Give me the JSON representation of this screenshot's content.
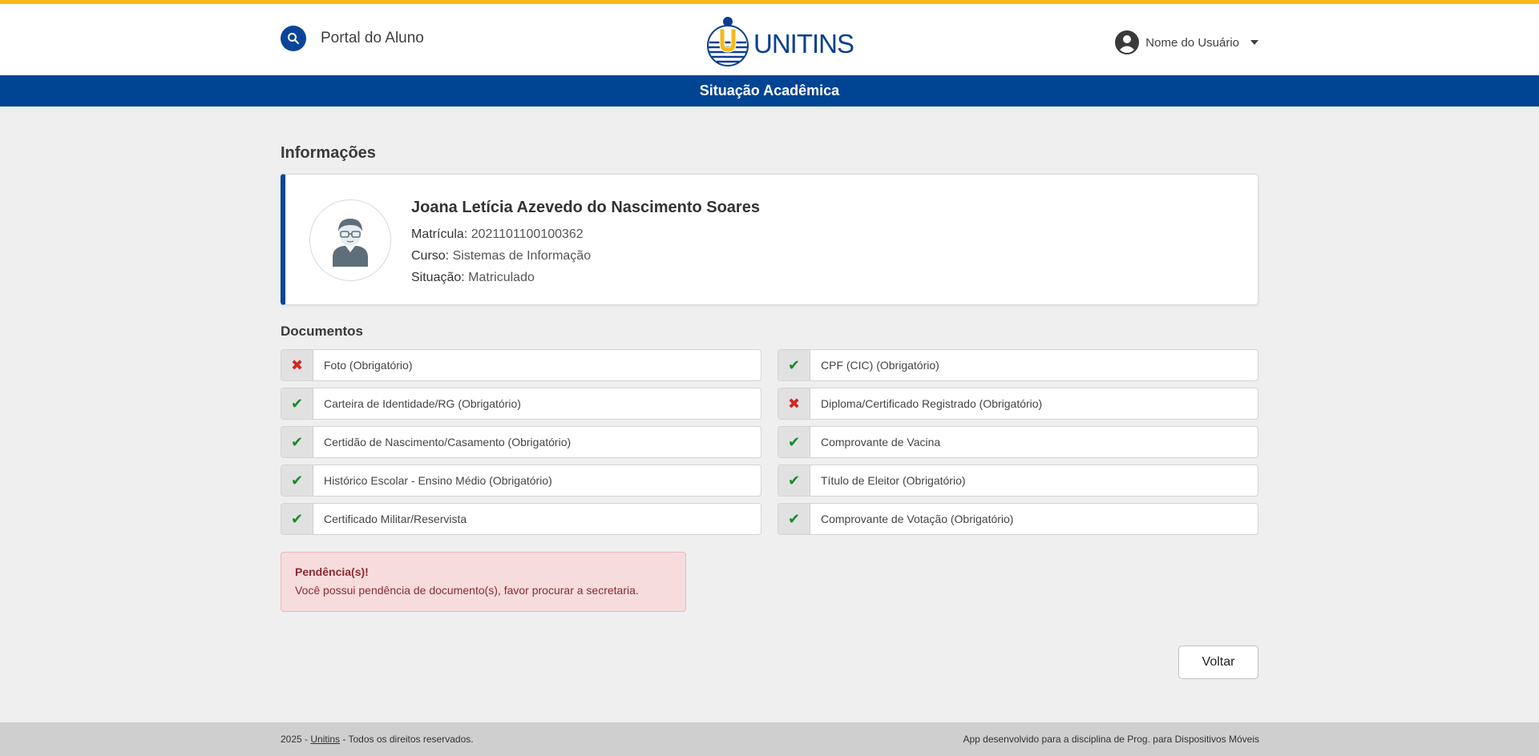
{
  "colors": {
    "accent_bar": "#f7b81a",
    "primary": "#004494",
    "success": "#1a8a2c",
    "danger": "#d22626",
    "alert_bg": "#f7dcde"
  },
  "header": {
    "portal_title": "Portal do Aluno",
    "search_icon": "search-icon",
    "logo_text": "UNITINS",
    "user_name": "Nome do Usuário",
    "user_icon": "user-circle-icon"
  },
  "page_title": "Situação Acadêmica",
  "info": {
    "section_title": "Informações",
    "student_name": "Joana Letícia Azevedo do Nascimento Soares",
    "matricula_label": "Matrícula:",
    "matricula_value": "2021101100100362",
    "curso_label": "Curso:",
    "curso_value": "Sistemas de Informação",
    "situacao_label": "Situação:",
    "situacao_value": "Matriculado"
  },
  "documents": {
    "title": "Documentos",
    "items": [
      {
        "label": "Foto (Obrigatório)",
        "ok": false
      },
      {
        "label": "CPF (CIC) (Obrigatório)",
        "ok": true
      },
      {
        "label": "Carteira de Identidade/RG (Obrigatório)",
        "ok": true
      },
      {
        "label": "Diploma/Certificado Registrado (Obrigatório)",
        "ok": false
      },
      {
        "label": "Certidão de Nascimento/Casamento (Obrigatório)",
        "ok": true
      },
      {
        "label": "Comprovante de Vacina",
        "ok": true
      },
      {
        "label": "Histórico Escolar - Ensino Médio (Obrigatório)",
        "ok": true
      },
      {
        "label": "Título de Eleitor (Obrigatório)",
        "ok": true
      },
      {
        "label": "Certificado Militar/Reservista",
        "ok": true
      },
      {
        "label": "Comprovante de Votação (Obrigatório)",
        "ok": true
      }
    ]
  },
  "alert": {
    "title": "Pendência(s)!",
    "text": "Você possui pendência de documento(s), favor procurar a secretaria."
  },
  "back_button": "Voltar",
  "footer": {
    "year_prefix": "2025 - ",
    "link_text": "Unitins",
    "rights": " - Todos os direitos reservados.",
    "right_text": "App desenvolvido para a disciplina de Prog. para Dispositivos Móveis"
  }
}
